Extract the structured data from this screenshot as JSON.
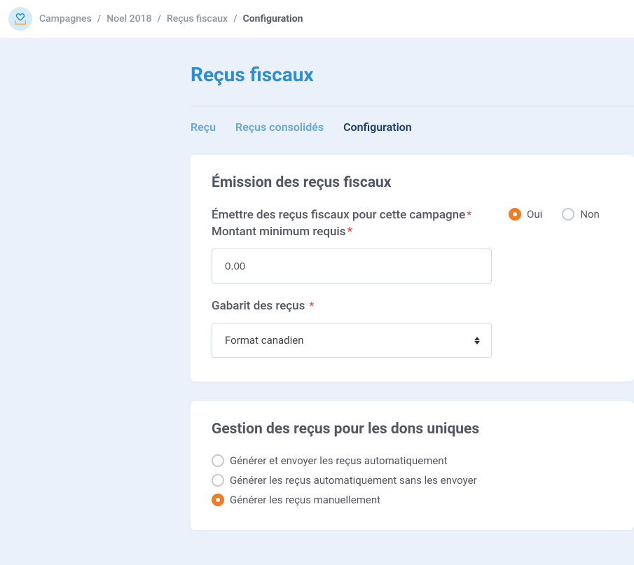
{
  "breadcrumb": {
    "items": [
      "Campagnes",
      "Noel 2018",
      "Reçus fiscaux"
    ],
    "active": "Configuration"
  },
  "page_title": "Reçus fiscaux",
  "tabs": {
    "items": [
      "Reçu",
      "Reçus consolidés"
    ],
    "active": "Configuration"
  },
  "card1": {
    "title": "Émission des reçus fiscaux",
    "emit_label": "Émettre des reçus fiscaux pour cette campagne",
    "emit_options": {
      "yes": "Oui",
      "no": "Non"
    },
    "min_label": "Montant minimum requis",
    "min_value": "0.00",
    "template_label": "Gabarit des reçus",
    "template_value": "Format canadien"
  },
  "card2": {
    "title": "Gestion des reçus pour les dons uniques",
    "options": [
      "Générer et envoyer les reçus automatiquement",
      "Générer les reçus automatiquement sans les envoyer",
      "Générer les reçus manuellement"
    ]
  }
}
